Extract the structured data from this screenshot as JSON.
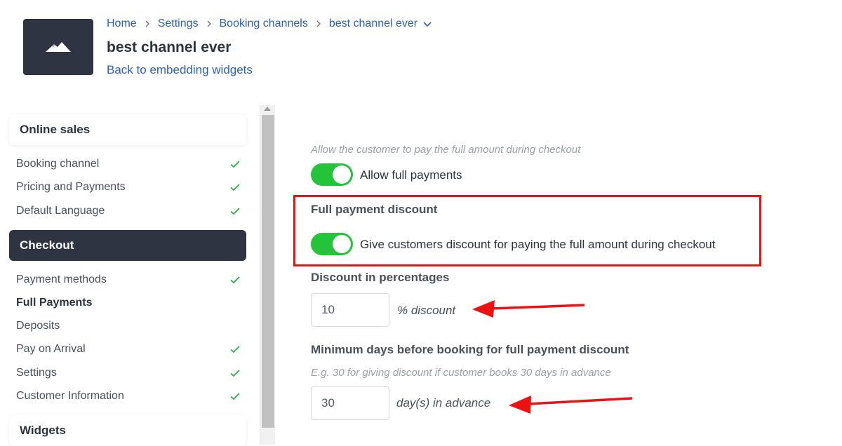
{
  "header": {
    "breadcrumb": [
      "Home",
      "Settings",
      "Booking channels",
      "best channel ever"
    ],
    "title": "best channel ever",
    "back_link": "Back to embedding widgets"
  },
  "sidebar": {
    "sections": {
      "online_sales": "Online sales",
      "checkout": "Checkout",
      "widgets": "Widgets"
    },
    "online_sales_items": [
      {
        "label": "Booking channel",
        "done": true
      },
      {
        "label": "Pricing and Payments",
        "done": true
      },
      {
        "label": "Default Language",
        "done": true
      }
    ],
    "checkout_items": [
      {
        "label": "Payment methods",
        "done": true
      },
      {
        "label": "Full Payments",
        "done": false,
        "active": true
      },
      {
        "label": "Deposits",
        "done": false
      },
      {
        "label": "Pay on Arrival",
        "done": true
      },
      {
        "label": "Settings",
        "done": true
      },
      {
        "label": "Customer Information",
        "done": true
      }
    ]
  },
  "main": {
    "full_payments_hint": "Allow the customer to pay the full amount during checkout",
    "allow_full_payments_label": "Allow full payments",
    "allow_full_payments_on": true,
    "discount_title": "Full payment discount",
    "discount_toggle_label": "Give customers discount for paying the full amount during checkout",
    "discount_toggle_on": true,
    "percent_title": "Discount in percentages",
    "percent_value": "10",
    "percent_unit": "% discount",
    "min_days_title": "Minimum days before booking for full payment discount",
    "min_days_hint": "E.g. 30 for giving discount if customer books 30 days in advance",
    "min_days_value": "30",
    "min_days_unit": "day(s) in advance"
  },
  "colors": {
    "accent_link": "#2a5fc7",
    "toggle_on": "#23c33a",
    "check": "#2ab63c",
    "dark": "#2e3441",
    "annotation": "#ee1111"
  }
}
